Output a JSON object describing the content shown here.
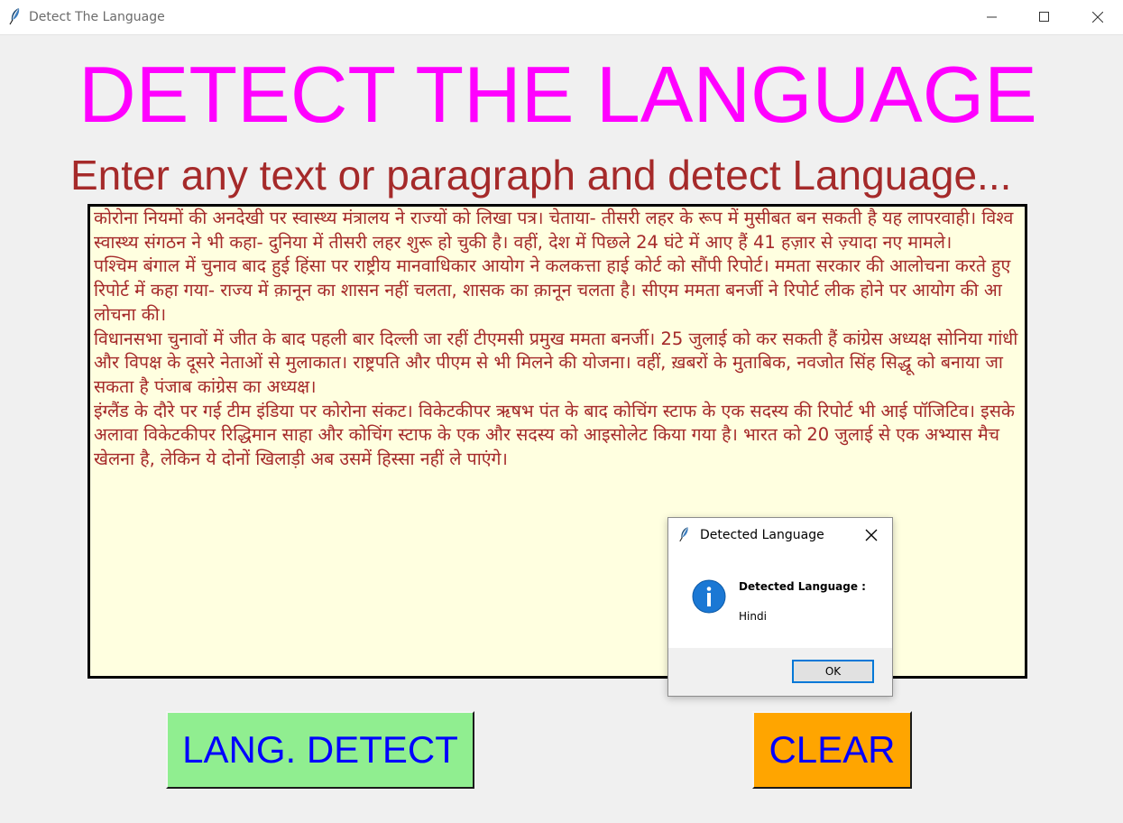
{
  "window": {
    "title": "Detect The Language"
  },
  "heading": "DETECT THE LANGUAGE",
  "subheading": "Enter any text or paragraph and detect Language...",
  "textbox": {
    "content": "कोरोना नियमों की अनदेखी पर स्वास्थ्य मंत्रालय ने राज्यों को लिखा पत्र। चेताया- तीसरी लहर के रूप में मुसीबत बन सकती है यह लापरवाही। विश्व स्वास्थ्य संगठन ने भी कहा- दुनिया में तीसरी लहर शुरू हो चुकी है। वहीं, देश में पिछले 24 घंटे में आए हैं 41 हज़ार से ज़्यादा नए मामले।\nपश्चिम बंगाल में चुनाव बाद हुई हिंसा पर राष्ट्रीय मानवाधिकार आयोग ने कलकत्ता हाई कोर्ट को सौंपी रिपोर्ट। ममता सरकार की आलोचना करते हुए रिपोर्ट में कहा गया- राज्य में क़ानून का शासन नहीं चलता, शासक का क़ानून चलता है। सीएम ममता बनर्जी ने रिपोर्ट लीक होने पर आयोग की आलोचना की।\nविधानसभा चुनावों में जीत के बाद पहली बार दिल्ली जा रहीं टीएमसी प्रमुख ममता बनर्जी। 25 जुलाई को कर सकती हैं कांग्रेस अध्यक्ष सोनिया गांधी और विपक्ष के दूसरे नेताओं से मुलाकात। राष्ट्रपति और पीएम से भी मिलने की योजना। वहीं, ख़बरों के मुताबिक, नवजोत सिंह सिद्धू को बनाया जा सकता है पंजाब कांग्रेस का अध्यक्ष।\nइंग्लैंड के दौरे पर गई टीम इंडिया पर कोरोना संकट। विकेटकीपर ऋषभ पंत के बाद कोचिंग स्टाफ के एक सदस्य की रिपोर्ट भी आई पॉजिटिव। इसके अलावा विकेटकीपर रिद्धिमान साहा और कोचिंग स्टाफ के एक और सदस्य को आइसोलेट किया गया है। भारत को 20 जुलाई से एक अभ्यास मैच खेलना है, लेकिन ये दोनों खिलाड़ी अब उसमें हिस्सा नहीं ले पाएंगे।"
  },
  "buttons": {
    "detect": "LANG. DETECT",
    "clear": "CLEAR"
  },
  "dialog": {
    "title": "Detected Language",
    "message_label": "Detected Language :",
    "message_value": "Hindi",
    "ok": "OK"
  },
  "colors": {
    "heading": "#ff00ff",
    "subheading": "#a52a2a",
    "textbox_bg": "#ffffe0",
    "detect_bg": "#90ee90",
    "clear_bg": "#ffa500",
    "button_text": "#0000ff"
  },
  "icons": [
    "feather-icon",
    "minimize-icon",
    "maximize-icon",
    "close-icon",
    "info-icon"
  ]
}
